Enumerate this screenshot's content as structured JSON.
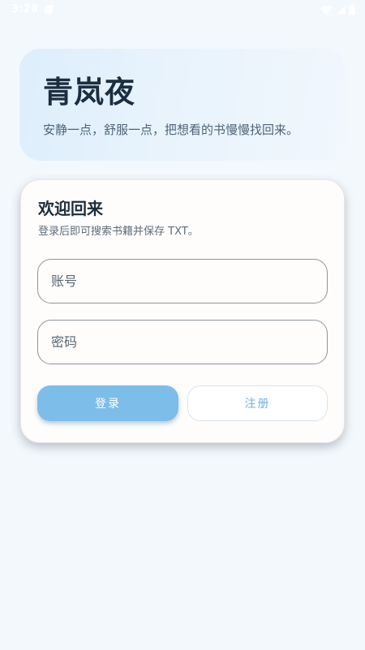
{
  "status_bar": {
    "time": "3:28",
    "icons": [
      "notification-icon",
      "wifi-icon",
      "signal-icon",
      "battery-icon"
    ]
  },
  "hero": {
    "title": "青岚夜",
    "subtitle": "安静一点，舒服一点，把想看的书慢慢找回来。"
  },
  "login_card": {
    "title": "欢迎回来",
    "subtitle": "登录后即可搜索书籍并保存 TXT。",
    "account_placeholder": "账号",
    "password_placeholder": "密码",
    "login_label": "登录",
    "register_label": "注册"
  },
  "colors": {
    "background": "#f3f8fc",
    "primary_button": "#7dbdea",
    "register_text": "#72b2df",
    "title_text": "#1c2e40"
  }
}
